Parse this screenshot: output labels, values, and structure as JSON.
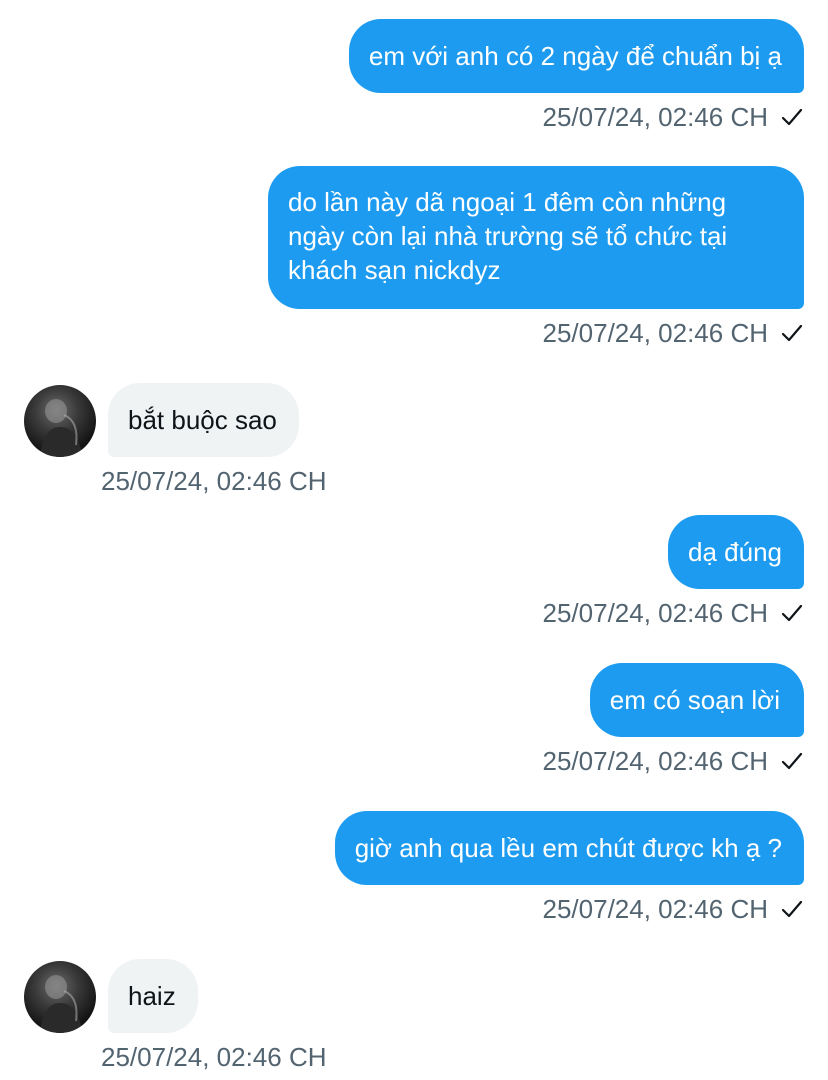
{
  "conversation": {
    "messages": [
      {
        "direction": "out",
        "text": "em với anh có 2 ngày để chuẩn bị ạ",
        "time": "25/07/24, 02:46 CH"
      },
      {
        "direction": "out",
        "text": "do lần này dã ngoại 1 đêm còn những ngày còn lại nhà trường sẽ tổ chức tại khách sạn nickdyz",
        "time": "25/07/24, 02:46 CH"
      },
      {
        "direction": "in",
        "text": "bắt buộc sao",
        "time": "25/07/24, 02:46 CH",
        "avatar_icon": "profile-photo"
      },
      {
        "direction": "out",
        "text": "dạ đúng",
        "time": "25/07/24, 02:46 CH"
      },
      {
        "direction": "out",
        "text": "em có soạn lời",
        "time": "25/07/24, 02:46 CH"
      },
      {
        "direction": "out",
        "text": "giờ anh qua lều em chút được kh ạ ?",
        "time": "25/07/24, 02:46 CH"
      },
      {
        "direction": "in",
        "text": "haiz",
        "time": "25/07/24, 02:46 CH",
        "avatar_icon": "profile-photo"
      }
    ]
  },
  "theme": {
    "outgoing_bubble": "#1d9bf0",
    "incoming_bubble": "#eff3f4",
    "timestamp_color": "#536471",
    "sent_icon": "checkmark-icon"
  }
}
